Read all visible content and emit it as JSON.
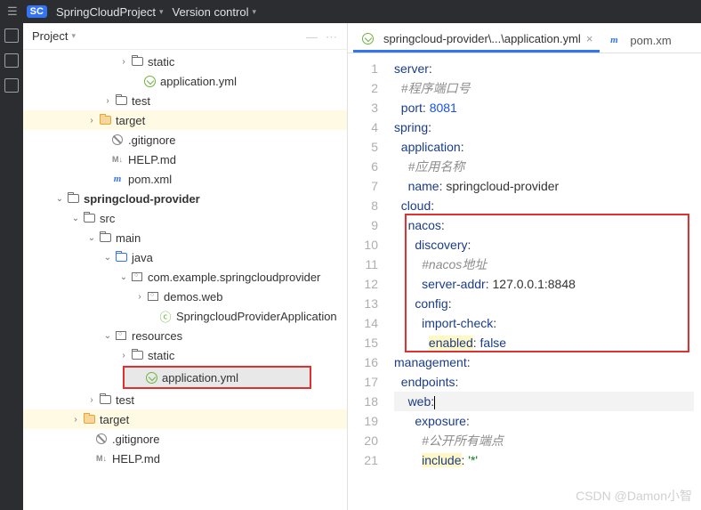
{
  "topbar": {
    "badge": "SC",
    "project_name": "SpringCloudProject",
    "vcs_label": "Version control"
  },
  "project_panel": {
    "title": "Project"
  },
  "tree": {
    "n1": "static",
    "n2": "application.yml",
    "n3": "test",
    "n4": "target",
    "n5": ".gitignore",
    "n6": "HELP.md",
    "n7": "pom.xml",
    "n8": "springcloud-provider",
    "n9": "src",
    "n10": "main",
    "n11": "java",
    "n12": "com.example.springcloudprovider",
    "n13": "demos.web",
    "n14": "SpringcloudProviderApplication",
    "n15": "resources",
    "n16": "static",
    "n17": "application.yml",
    "n18": "test",
    "n19": "target",
    "n20": ".gitignore",
    "n21": "HELP.md"
  },
  "tabs": {
    "active": "springcloud-provider\\...\\application.yml",
    "other": "pom.xm"
  },
  "code": {
    "l1_k": "server",
    "l1_c": ":",
    "l2": "#程序端口号",
    "l3_k": "port",
    "l3_v": "8081",
    "l4_k": "spring",
    "l5_k": "application",
    "l6": "#应用名称",
    "l7_k": "name",
    "l7_v": "springcloud-provider",
    "l8_k": "cloud",
    "l9_k": "nacos",
    "l10_k": "discovery",
    "l11": "#nacos地址",
    "l12_k": "server-addr",
    "l12_v": "127.0.0.1:8848",
    "l13_k": "config",
    "l14_k": "import-check",
    "l15_k": "enabled",
    "l15_v": "false",
    "l16_k": "management",
    "l17_k": "endpoints",
    "l18_k": "web",
    "l19_k": "exposure",
    "l20": "#公开所有端点",
    "l21_k": "include",
    "l21_v": "'*'"
  },
  "gutter": {
    "1": "1",
    "2": "2",
    "3": "3",
    "4": "4",
    "5": "5",
    "6": "6",
    "7": "7",
    "8": "8",
    "9": "9",
    "10": "10",
    "11": "11",
    "12": "12",
    "13": "13",
    "14": "14",
    "15": "15",
    "16": "16",
    "17": "17",
    "18": "18",
    "19": "19",
    "20": "20",
    "21": "21"
  },
  "watermark": "CSDN @Damon小智"
}
